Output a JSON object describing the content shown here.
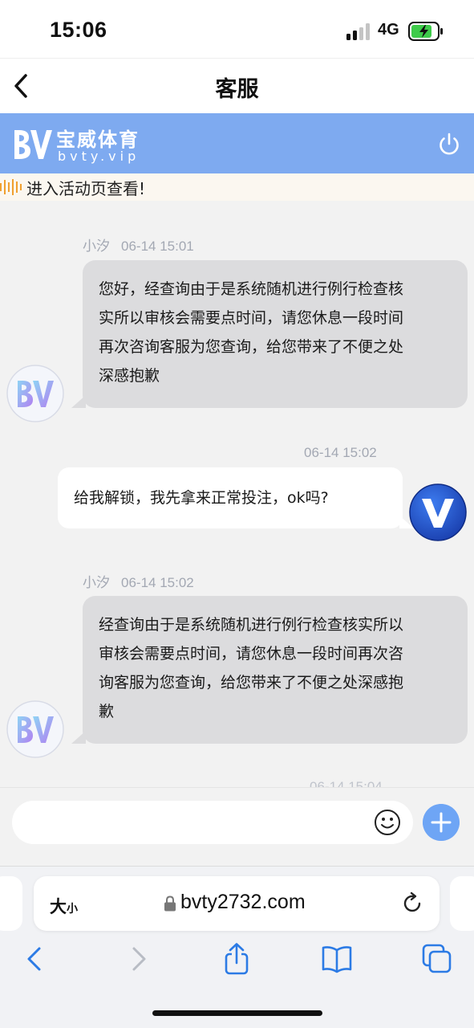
{
  "status_bar": {
    "time": "15:06",
    "network": "4G",
    "battery_state": "charging"
  },
  "nav": {
    "title": "客服",
    "back_icon": "chevron-left-icon"
  },
  "brand": {
    "logo_text": "BV",
    "name": "宝威体育",
    "domain": "bvty.vip",
    "accent_color": "#7eaaf0",
    "power_icon": "power-icon"
  },
  "notice": {
    "text": "进入活动页查看!"
  },
  "messages": [
    {
      "direction": "incoming",
      "sender": "小汐",
      "time": "06-14 15:01",
      "lines": [
        "您好，经查询由于是系统随机进行例行检查核",
        "实所以审核会需要点时间，请您休息一段时间",
        "再次咨询客服为您查询，给您带来了不便之处",
        "深感抱歉"
      ]
    },
    {
      "direction": "outgoing",
      "time": "06-14 15:02",
      "lines": [
        "给我解锁，我先拿来正常投注，ok吗?"
      ]
    },
    {
      "direction": "incoming",
      "sender": "小汐",
      "time": "06-14 15:02",
      "lines": [
        "经查询由于是系统随机进行例行检查核实所以",
        "审核会需要点时间，请您休息一段时间再次咨",
        "询客服为您查询，给您带来了不便之处深感抱",
        "歉"
      ]
    }
  ],
  "partial_meta": "06-14 15:04",
  "input": {
    "placeholder": "",
    "emoji_icon": "smiley-icon",
    "plus_icon": "plus-icon",
    "plus_color": "#6ea5f5"
  },
  "browser": {
    "text_size_label": "大",
    "text_size_small": "小",
    "url": "bvty2732.com",
    "toolbar_icons": [
      "back-icon",
      "forward-icon",
      "share-icon",
      "bookmarks-icon",
      "tabs-icon"
    ]
  }
}
